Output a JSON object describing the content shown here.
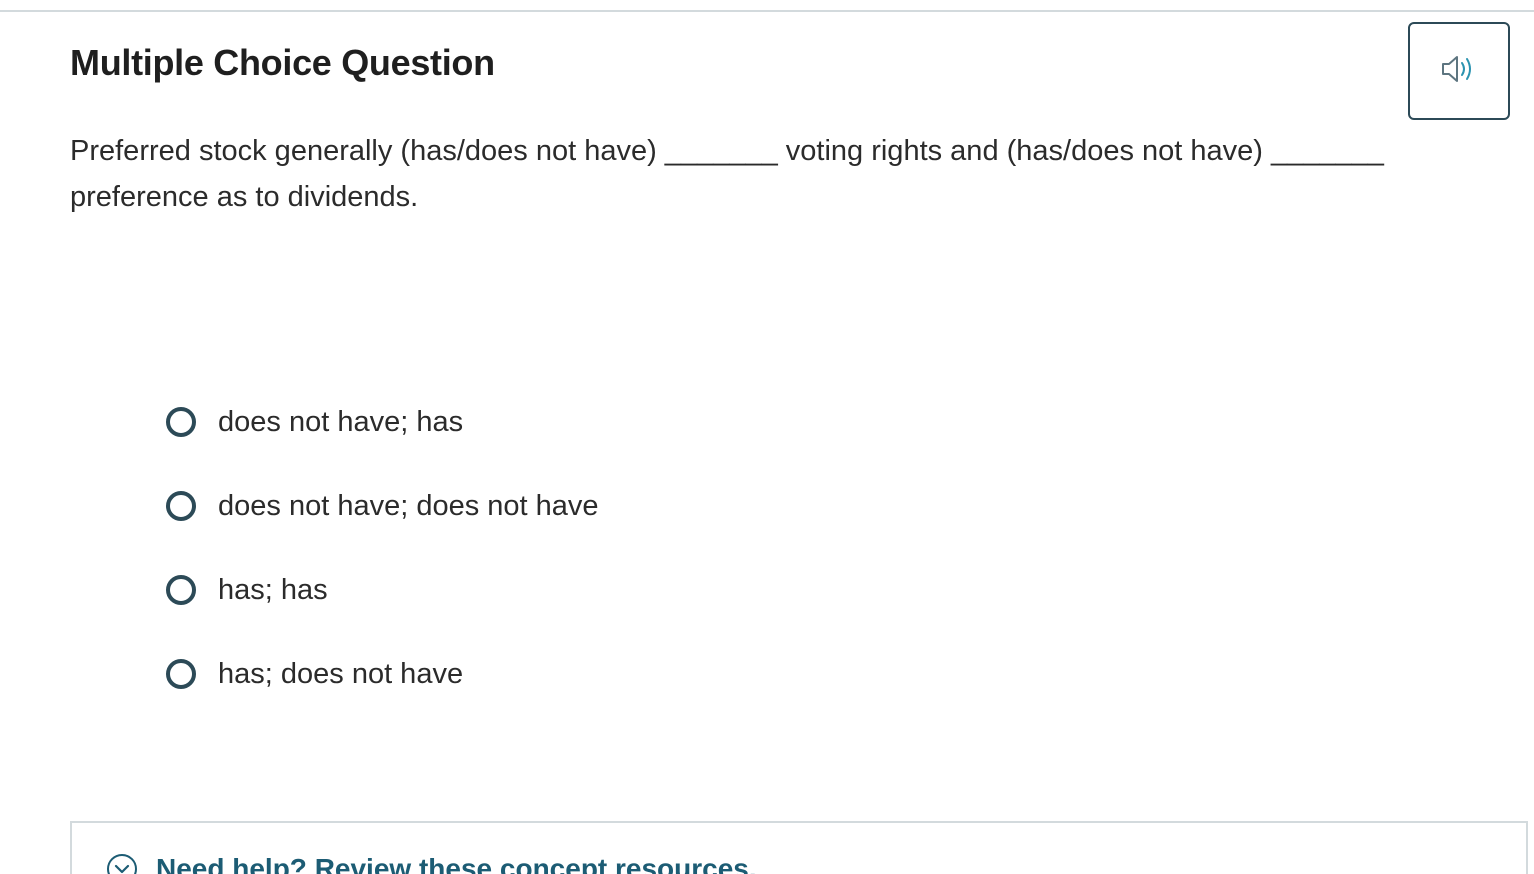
{
  "question": {
    "title": "Multiple Choice Question",
    "prompt_line1": "Preferred stock generally (has/does not have) _______ voting rights and (has/does not have) _______",
    "prompt_line2": "preference as to dividends."
  },
  "audio_button": {
    "icon": "speaker-icon",
    "color": "#2c4a57"
  },
  "options": [
    {
      "label": "does not have; has",
      "selected": false
    },
    {
      "label": "does not have; does not have",
      "selected": false
    },
    {
      "label": "has; has",
      "selected": false
    },
    {
      "label": "has; does not have",
      "selected": false
    }
  ],
  "help": {
    "label": "Need help? Review these concept resources.",
    "icon": "chevron-down-circle-icon",
    "color": "#1c5c74"
  }
}
